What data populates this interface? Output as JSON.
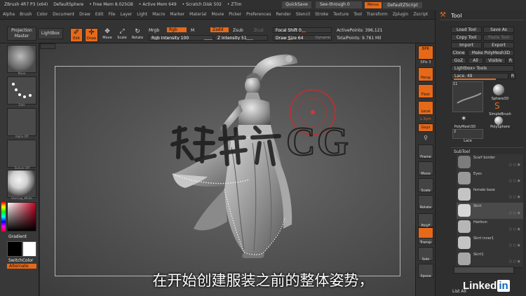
{
  "titlebar": {
    "app": "ZBrush 4R7 P3 (x64)",
    "tool": "DefaultSphere",
    "free_mem": "• Free Mem 8.025GB",
    "active_mem": "• Active Mem 649",
    "scratch_disk": "• Scratch Disk 502",
    "ztime": "• ZTim",
    "quicksave": "QuickSave",
    "see_through": "See-through  0",
    "menus": "Menus",
    "default_script": "DefaultZScript"
  },
  "menubar": [
    "Alpha",
    "Brush",
    "Color",
    "Document",
    "Draw",
    "Edit",
    "File",
    "Layer",
    "Light",
    "Macro",
    "Marker",
    "Material",
    "Movie",
    "Picker",
    "Preferences",
    "Render",
    "Stencil",
    "Stroke",
    "Texture",
    "Tool",
    "Transform",
    "Zplugin",
    "Zscript"
  ],
  "shelf": {
    "projection_master": "Projection Master",
    "lightbox": "LightBox",
    "edit": "Edit",
    "draw": "Draw",
    "move": "Move",
    "scale": "Scale",
    "rotate": "Rotate",
    "mrgb": "Mrgb",
    "rgb": "Rgb",
    "m": "M",
    "zadd": "Zadd",
    "zsub": "Zsub",
    "zcut": "Zcut",
    "rgb_intensity": "Rgb Intensity 100",
    "z_intensity": "Z Intensity 51",
    "focal_shift": "Focal Shift 0",
    "draw_size": "Draw Size 64",
    "dynamic": "Dynamic",
    "active_points": "ActivePoints: 396,121",
    "total_points": "TotalPoints: 9.781 Mil"
  },
  "left_panel": {
    "move": "Move",
    "dots": "Dots",
    "alpha_off": "Alpha Off",
    "texture_off": "Texture Off",
    "material": "SkinCap_White",
    "gradient": "Gradient",
    "switch_color": "SwitchColor",
    "alternate": "Alternate"
  },
  "right_tools": {
    "bpr": "BPR",
    "spix": "SPix 3",
    "persp": "Persp",
    "floor": "Floor",
    "local": "Local",
    "lsym": "L.Sym",
    "gxyz": "Gxyz",
    "frame": "Frame",
    "move": "Move",
    "scale": "Scale",
    "rotate": "Rotate",
    "polyf": "PolyF",
    "transp": "Transp",
    "solo": "Solo",
    "xpose": "Xpose"
  },
  "tool_panel": {
    "title": "Tool",
    "load_tool": "Load Tool",
    "save_as": "Save As",
    "copy_tool": "Copy Tool",
    "paste_tool": "Paste Tool",
    "import": "Import",
    "export": "Export",
    "clone": "Clone",
    "make_polymesh": "Make PolyMesh3D",
    "goz": "GoZ",
    "all": "All",
    "visible": "Visible",
    "r": "R",
    "lightbox_tools": "Lightbox» Tools",
    "lace": "Lace. 49",
    "tools": [
      "Sphere3D",
      "SimpleBrush",
      "PolyMesh3D",
      "PolySphere",
      "Lace"
    ],
    "count_11": "11",
    "count_2": "2",
    "subtool": "SubTool",
    "subtools": [
      "Scarf border",
      "Eyes",
      "female base",
      "Skirt",
      "Hairbun",
      "Skirt inner1",
      "Skirt1"
    ],
    "list_all": "List All"
  },
  "watermark": "CG",
  "subtitle": "在开始创建服装之前的整体姿势，",
  "linkedin": {
    "text": "Linked",
    "in": "in"
  },
  "colors": {
    "accent": "#e6691a",
    "panel": "#2e2e2e",
    "viewport": "#555555"
  }
}
